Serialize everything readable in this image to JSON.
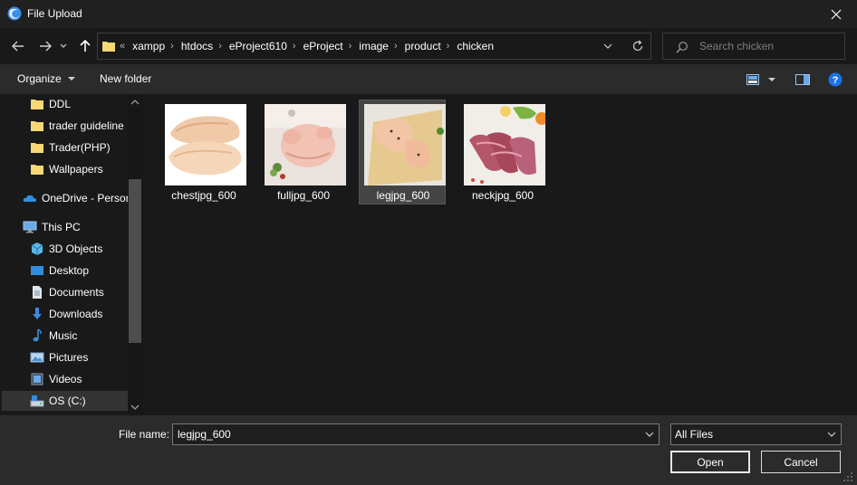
{
  "window": {
    "title": "File Upload"
  },
  "address": {
    "overflow": "«",
    "crumbs": [
      "xampp",
      "htdocs",
      "eProject610",
      "eProject",
      "image",
      "product",
      "chicken"
    ]
  },
  "search": {
    "placeholder": "Search chicken"
  },
  "toolbar": {
    "organize_label": "Organize",
    "new_folder_label": "New folder"
  },
  "sidebar": {
    "items": [
      {
        "label": "DDL",
        "icon": "folder-icon"
      },
      {
        "label": "trader guideline",
        "icon": "folder-icon"
      },
      {
        "label": "Trader(PHP)",
        "icon": "folder-icon"
      },
      {
        "label": "Wallpapers",
        "icon": "folder-icon"
      },
      {
        "label": "OneDrive - Person",
        "icon": "cloud-icon"
      },
      {
        "label": "This PC",
        "icon": "computer-icon"
      },
      {
        "label": "3D Objects",
        "icon": "cube-icon"
      },
      {
        "label": "Desktop",
        "icon": "desktop-icon"
      },
      {
        "label": "Documents",
        "icon": "document-icon"
      },
      {
        "label": "Downloads",
        "icon": "download-icon"
      },
      {
        "label": "Music",
        "icon": "music-icon"
      },
      {
        "label": "Pictures",
        "icon": "picture-icon"
      },
      {
        "label": "Videos",
        "icon": "video-icon"
      },
      {
        "label": "OS (C:)",
        "icon": "drive-icon"
      }
    ]
  },
  "files": [
    {
      "name": "chestjpg_600",
      "selected": false
    },
    {
      "name": "fulljpg_600",
      "selected": false
    },
    {
      "name": "legjpg_600",
      "selected": true
    },
    {
      "name": "neckjpg_600",
      "selected": false
    }
  ],
  "filename": {
    "label": "File name:",
    "value": "legjpg_600"
  },
  "filetype": {
    "value": "All Files"
  },
  "buttons": {
    "open": "Open",
    "cancel": "Cancel"
  },
  "colors": {
    "folder": "#f8d775",
    "accent": "#0078d7",
    "help": "#1a73e8",
    "selected_tile": "#444444"
  }
}
